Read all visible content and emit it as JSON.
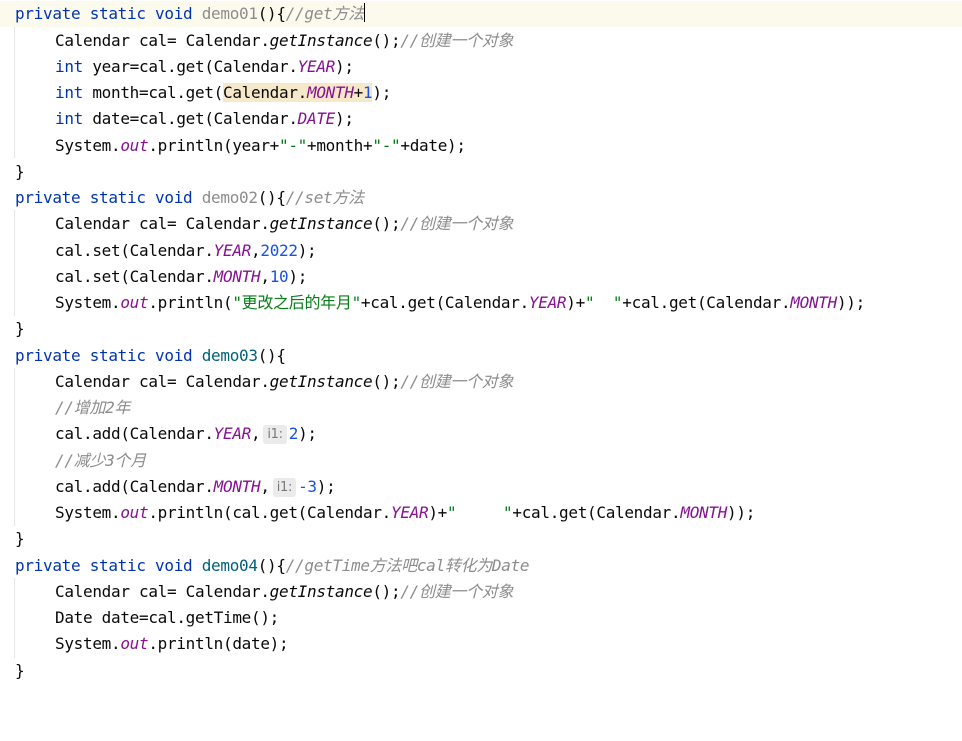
{
  "code": {
    "l1": {
      "kw1": "private",
      "kw2": "static",
      "kw3": "void",
      "name": "demo01",
      "punct": "(){",
      "comment": "//get方法"
    },
    "l2": {
      "t1": "Calendar cal= Calendar.",
      "call": "getInstance",
      "t2": "();",
      "comment": "//创建一个对象"
    },
    "l3": {
      "kw": "int",
      "t1": " year=cal.get(Calendar.",
      "const": "YEAR",
      "t2": ");"
    },
    "l4": {
      "kw": "int",
      "t1": " month=cal.get(",
      "hl1": "Calendar.",
      "const": "MONTH",
      "hl2": "+",
      "num": "1",
      "t2": ");"
    },
    "l5": {
      "kw": "int",
      "t1": " date=cal.get(Calendar.",
      "const": "DATE",
      "t2": ");"
    },
    "l6": {
      "t1": "System.",
      "out": "out",
      "t2": ".println(year+",
      "s1": "\"-\"",
      "t3": "+month+",
      "s2": "\"-\"",
      "t4": "+date);"
    },
    "l7": {
      "brace": "}"
    },
    "l8": {
      "kw1": "private",
      "kw2": "static",
      "kw3": "void",
      "name": "demo02",
      "punct": "(){",
      "comment": "//set方法"
    },
    "l9": {
      "t1": "Calendar cal= Calendar.",
      "call": "getInstance",
      "t2": "();",
      "comment": "//创建一个对象"
    },
    "l10": {
      "t1": "cal.set(Calendar.",
      "const": "YEAR",
      "t2": ",",
      "num": "2022",
      "t3": ");"
    },
    "l11": {
      "t1": "cal.set(Calendar.",
      "const": "MONTH",
      "t2": ",",
      "num": "10",
      "t3": ");"
    },
    "l12": {
      "t1": "System.",
      "out": "out",
      "t2": ".println(",
      "s1": "\"更改之后的年月\"",
      "t3": "+cal.get(Calendar.",
      "c1": "YEAR",
      "t4": ")+",
      "s2": "\"  \"",
      "t5": "+cal.get(Calendar.",
      "c2": "MONTH",
      "t6": "));"
    },
    "l13": {
      "brace": "}"
    },
    "l14": {
      "kw1": "private",
      "kw2": "static",
      "kw3": "void",
      "name": "demo03",
      "punct": "(){"
    },
    "l15": {
      "t1": "Calendar cal= Calendar.",
      "call": "getInstance",
      "t2": "();",
      "comment": "//创建一个对象"
    },
    "l16": {
      "comment": "//增加2年"
    },
    "l17": {
      "t1": "cal.add(Calendar.",
      "const": "YEAR",
      "t2": ",",
      "hint": "i1:",
      "num": "2",
      "t3": ");"
    },
    "l18": {
      "comment": "//减少3个月"
    },
    "l19": {
      "t1": "cal.add(Calendar.",
      "const": "MONTH",
      "t2": ",",
      "hint": "i1:",
      "num": "-3",
      "t3": ");"
    },
    "l20": {
      "t1": "System.",
      "out": "out",
      "t2": ".println(cal.get(Calendar.",
      "c1": "YEAR",
      "t3": ")+",
      "s1": "\"     \"",
      "t4": "+cal.get(Calendar.",
      "c2": "MONTH",
      "t5": "));"
    },
    "l21": {
      "brace": "}"
    },
    "l22": {
      "kw1": "private",
      "kw2": "static",
      "kw3": "void",
      "name": "demo04",
      "punct": "(){",
      "comment": "//getTime方法吧cal转化为Date"
    },
    "l23": {
      "t1": "Calendar cal= Calendar.",
      "call": "getInstance",
      "t2": "();",
      "comment": "//创建一个对象"
    },
    "l24": {
      "t1": "Date date=cal.getTime();"
    },
    "l25": {
      "t1": "System.",
      "out": "out",
      "t2": ".println(date);"
    },
    "l26": {
      "brace": "}"
    }
  }
}
